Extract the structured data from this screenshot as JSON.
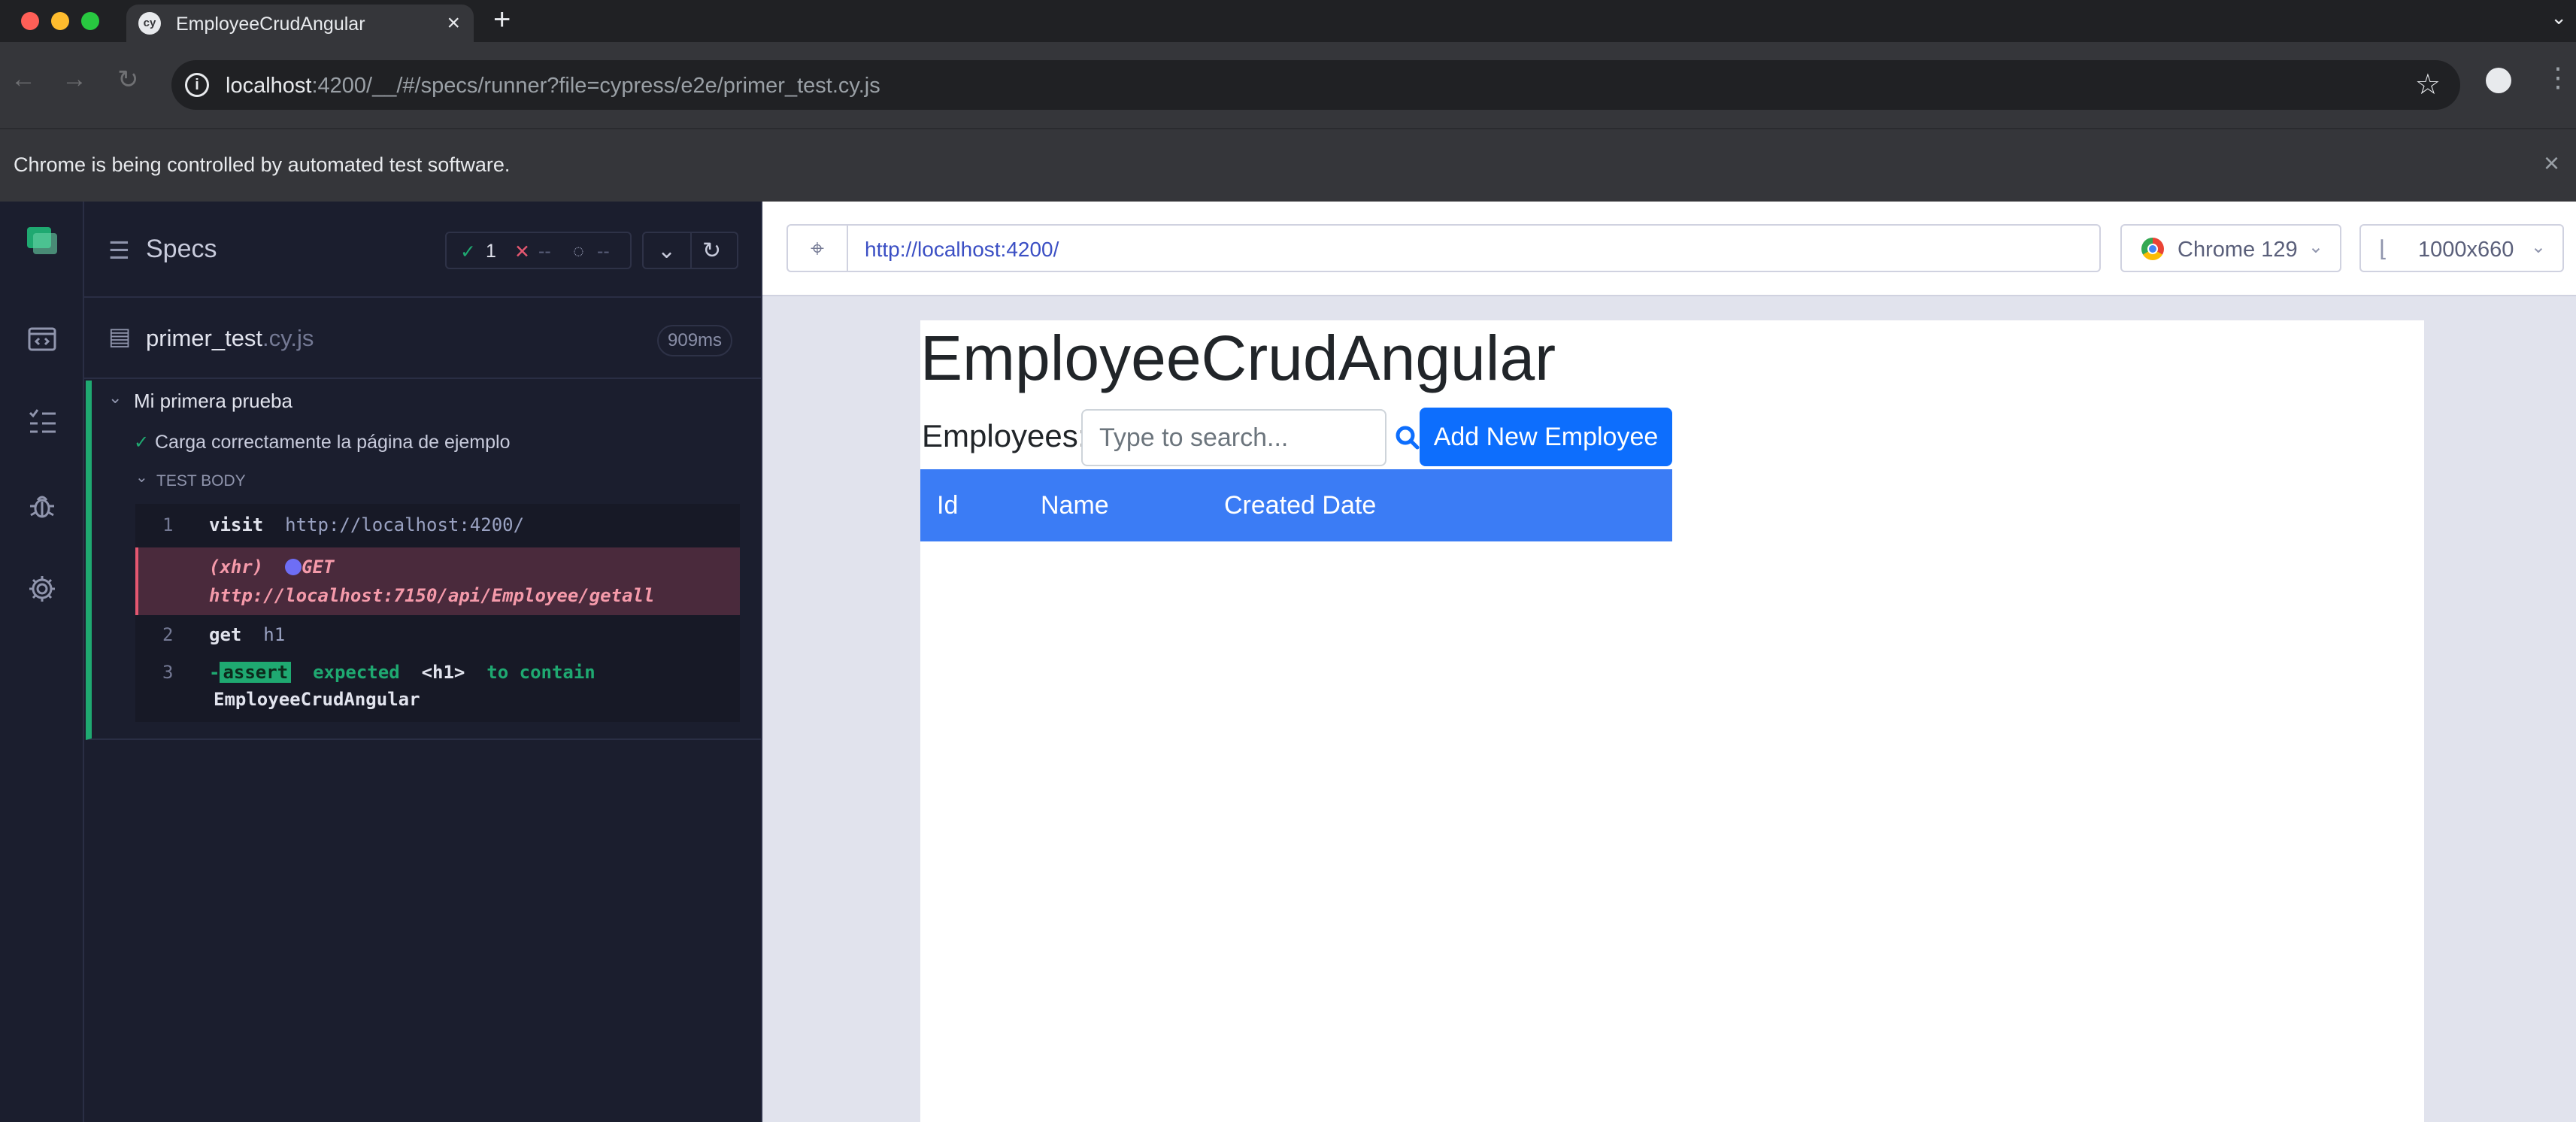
{
  "browser": {
    "tab_title": "EmployeeCrudAngular",
    "tab_favicon": "cy",
    "url_host": "localhost",
    "url_rest": ":4200/__/#/specs/runner?file=cypress/e2e/primer_test.cy.js",
    "infobar_message": "Chrome is being controlled by automated test software."
  },
  "reporter": {
    "title": "Specs",
    "passed": "1",
    "failed": "--",
    "pending": "--",
    "spec_name": "primer_test",
    "spec_ext": ".cy.js",
    "duration": "909ms",
    "suite_title": "Mi primera prueba",
    "test_title": "Carga correctamente la página de ejemplo",
    "test_body_label": "TEST BODY",
    "commands": [
      {
        "num": "1",
        "name": "visit",
        "arg": "http://localhost:4200/"
      },
      {
        "xhr_label": "(xhr)",
        "method": "GET",
        "url": "http://localhost:7150/api/Employee/getall"
      },
      {
        "num": "2",
        "name": "get",
        "arg": "h1"
      },
      {
        "num": "3",
        "prefix": "-",
        "badge": "assert",
        "text1": "expected",
        "tag": "<h1>",
        "text2": "to contain",
        "text3": "EmployeeCrudAngular"
      }
    ]
  },
  "aut": {
    "url": "http://localhost:4200/",
    "browser_label": "Chrome 129",
    "viewport_label": "1000x660"
  },
  "app": {
    "heading": "EmployeeCrudAngular",
    "employees_label": "Employees:",
    "search_placeholder": "Type to search...",
    "add_button": "Add New Employee",
    "columns": [
      "Id",
      "Name",
      "Created Date"
    ]
  },
  "colors": {
    "pass_green": "#1fa971",
    "fail_red": "#e45770",
    "primary_blue": "#0d6efd",
    "table_header_blue": "#3b7cf5"
  }
}
